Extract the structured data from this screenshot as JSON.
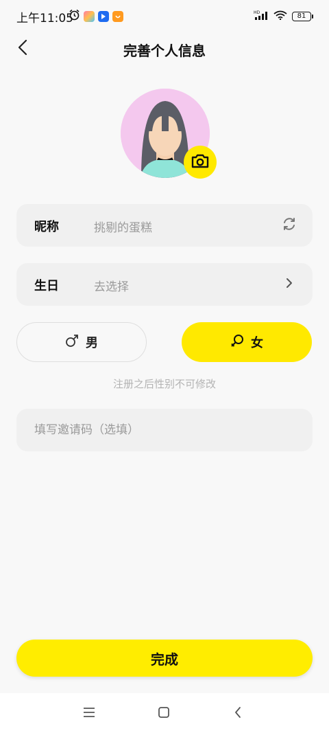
{
  "status_bar": {
    "time": "上午11:05",
    "battery": "81",
    "network": "HD"
  },
  "header": {
    "title": "完善个人信息"
  },
  "nickname": {
    "label": "昵称",
    "value": "挑剔的蛋糕"
  },
  "birthday": {
    "label": "生日",
    "value": "去选择"
  },
  "gender": {
    "male_label": "男",
    "female_label": "女",
    "selected": "女"
  },
  "note": "注册之后性别不可修改",
  "invite": {
    "placeholder": "填写邀请码（选填）"
  },
  "submit": {
    "label": "完成"
  },
  "colors": {
    "accent": "#ffed00",
    "background": "#f8f8f8",
    "field_bg": "#f0f0f0",
    "placeholder": "#9a9a9a"
  },
  "icons": [
    "back-arrow-icon",
    "camera-icon",
    "refresh-icon",
    "chevron-right-icon",
    "male-icon",
    "female-icon",
    "menu-icon",
    "home-icon",
    "back-nav-icon"
  ]
}
